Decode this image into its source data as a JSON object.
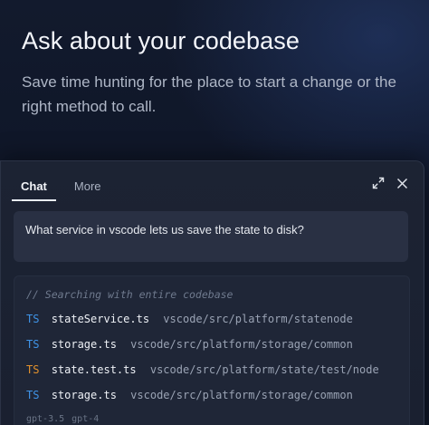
{
  "hero": {
    "title": "Ask about your codebase",
    "subtitle": "Save time hunting for the place to start a change or the right method to call."
  },
  "panel": {
    "tabs": [
      {
        "label": "Chat",
        "active": true
      },
      {
        "label": "More",
        "active": false
      }
    ],
    "icons": [
      "expand-icon",
      "close-icon"
    ],
    "question": "What service in vscode lets us save the state to disk?",
    "search_note": "// Searching with entire codebase",
    "files": [
      {
        "lang": "TS",
        "name": "stateService.ts",
        "path": "vscode/src/platform/statenode",
        "lang_color": "#3f93e6"
      },
      {
        "lang": "TS",
        "name": "storage.ts",
        "path": "vscode/src/platform/storage/common",
        "lang_color": "#3f93e6"
      },
      {
        "lang": "TS",
        "name": "state.test.ts",
        "path": "vscode/src/platform/state/test/node",
        "lang_color": "#e2912c"
      },
      {
        "lang": "TS",
        "name": "storage.ts",
        "path": "vscode/src/platform/storage/common",
        "lang_color": "#3f93e6"
      }
    ],
    "models": [
      "gpt-3.5",
      "gpt-4"
    ]
  }
}
